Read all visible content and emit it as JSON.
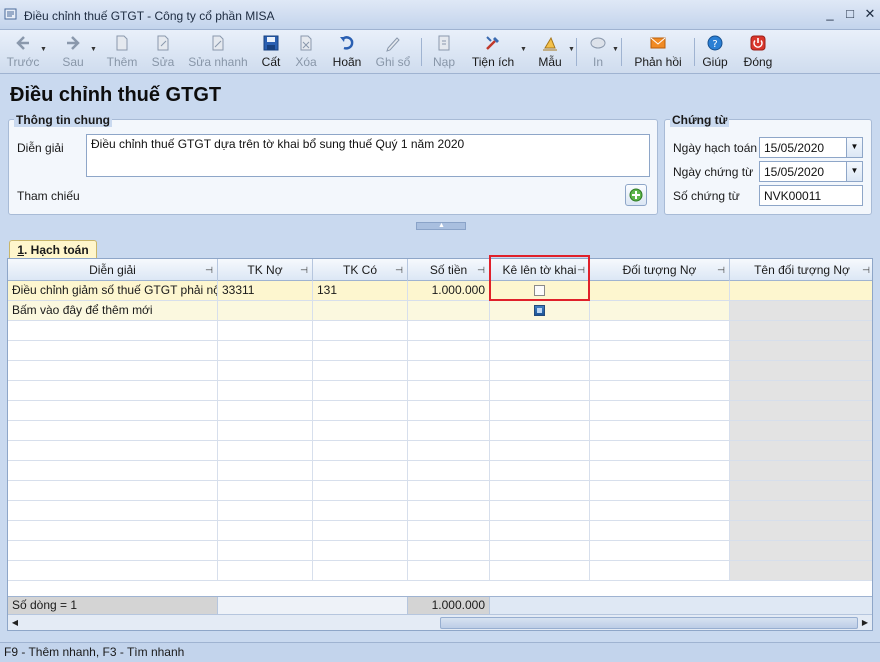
{
  "window": {
    "title": "Điều chỉnh thuế GTGT - Công ty cổ phần MISA",
    "minimize": "_",
    "maximize": "□",
    "close": "✕"
  },
  "toolbar": {
    "prev": "Trước",
    "next": "Sau",
    "add": "Thêm",
    "edit": "Sửa",
    "quick_edit": "Sửa nhanh",
    "save": "Cất",
    "delete": "Xóa",
    "undo": "Hoãn",
    "post": "Ghi sổ",
    "load": "Nạp",
    "utilities": "Tiện ích",
    "template": "Mẫu",
    "print": "In",
    "feedback": "Phản hồi",
    "help": "Giúp",
    "close": "Đóng"
  },
  "page_title": "Điều chỉnh thuế GTGT",
  "general_info": {
    "title": "Thông tin chung",
    "description_label": "Diễn giải",
    "description_value": "Điều chỉnh thuế GTGT dựa trên tờ khai bổ sung thuế Quý 1 năm 2020",
    "reference_label": "Tham chiếu"
  },
  "voucher": {
    "title": "Chứng từ",
    "posting_date_label": "Ngày hạch toán",
    "posting_date_value": "15/05/2020",
    "voucher_date_label": "Ngày chứng từ",
    "voucher_date_value": "15/05/2020",
    "voucher_no_label": "Số chứng từ",
    "voucher_no_value": "NVK00011"
  },
  "tab": {
    "number": "1",
    "label": ". Hạch toán"
  },
  "grid": {
    "columns": [
      "Diễn giải",
      "TK Nợ",
      "TK Có",
      "Số tiền",
      "Kê lên tờ khai",
      "Đối tượng Nợ",
      "Tên đối tượng Nợ"
    ],
    "rows": [
      {
        "description": "Điều chỉnh giảm số thuế GTGT phải nộp",
        "debit": "33311",
        "credit": "131",
        "amount": "1.000.000"
      }
    ],
    "new_row_text": "Bấm vào đây để thêm mới",
    "footer_count": "Số dòng = 1",
    "footer_total": "1.000.000"
  },
  "status": "F9 - Thêm nhanh, F3 - Tìm nhanh",
  "colors": {
    "highlight": "#e0202a",
    "row_yellow": "#fdf6cf",
    "window_bg": "#c9d9ef"
  }
}
